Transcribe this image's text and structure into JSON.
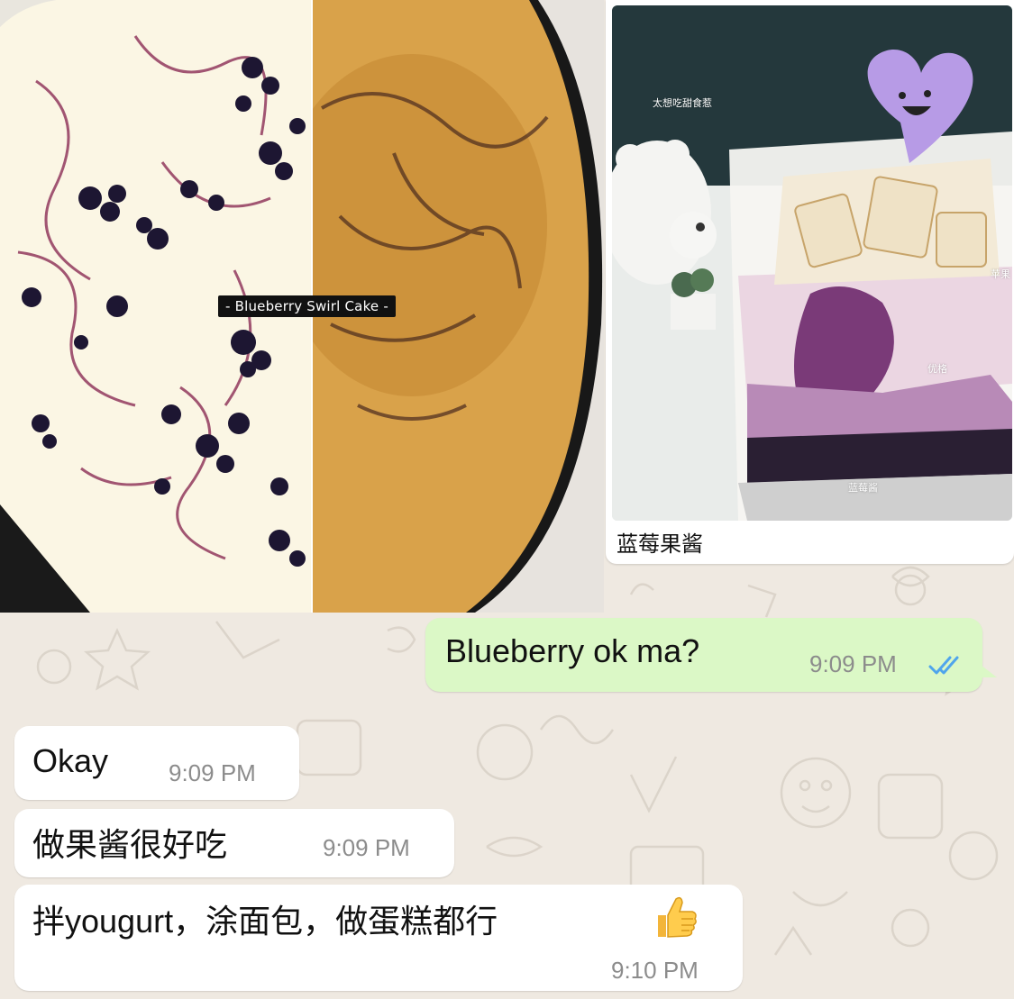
{
  "photos": {
    "cake_caption": "- Blueberry Swirl Cake -",
    "parfait_labels": {
      "top": "太想吃甜食惹",
      "yogurt": "优格",
      "jam": "蓝莓酱",
      "apple": "苹果"
    },
    "parfait_caption": "蓝莓果酱"
  },
  "messages": [
    {
      "direction": "outgoing",
      "text": "Blueberry ok ma?",
      "time": "9:09 PM",
      "status": "read",
      "status_color": "#4fa5ec"
    },
    {
      "direction": "incoming",
      "text": "Okay",
      "time": "9:09 PM"
    },
    {
      "direction": "incoming",
      "text": "做果酱很好吃",
      "time": "9:09 PM"
    },
    {
      "direction": "incoming",
      "text": "拌yougurt，涂面包，做蛋糕都行",
      "time": "9:10 PM",
      "emoji": "thumbs-up"
    }
  ],
  "colors": {
    "outgoing_bubble": "#dbf8c6",
    "incoming_bubble": "#ffffff",
    "wallpaper": "#efe9e1",
    "timestamp": "#8c8c8c"
  }
}
